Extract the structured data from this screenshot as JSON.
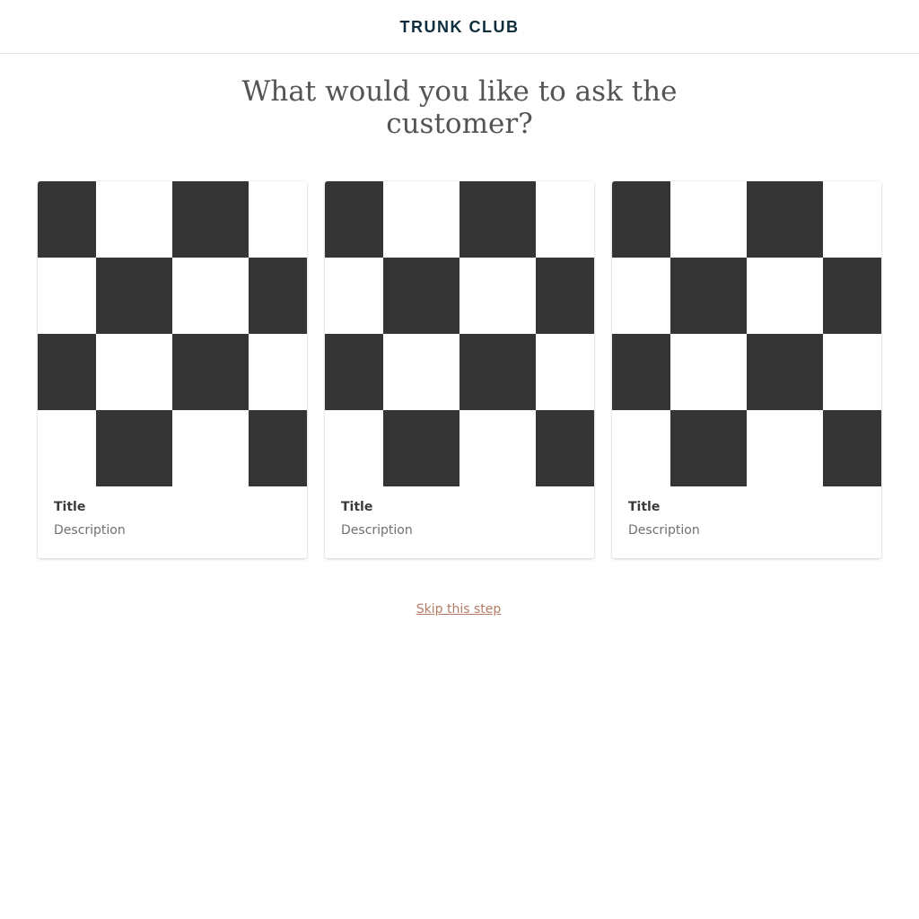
{
  "header": {
    "logo": "TRUNK CLUB"
  },
  "main": {
    "question": "What would you like to ask the customer?",
    "cards": [
      {
        "title": "Title",
        "description": "Description",
        "image": "checkerboard-placeholder"
      },
      {
        "title": "Title",
        "description": "Description",
        "image": "checkerboard-placeholder"
      },
      {
        "title": "Title",
        "description": "Description",
        "image": "checkerboard-placeholder"
      }
    ],
    "skip_label": "Skip this step"
  },
  "colors": {
    "logo": "#0f2d3d",
    "heading": "#545454",
    "placeholder_dark": "#353535",
    "placeholder_light": "#ffffff",
    "link": "#b57a66"
  }
}
